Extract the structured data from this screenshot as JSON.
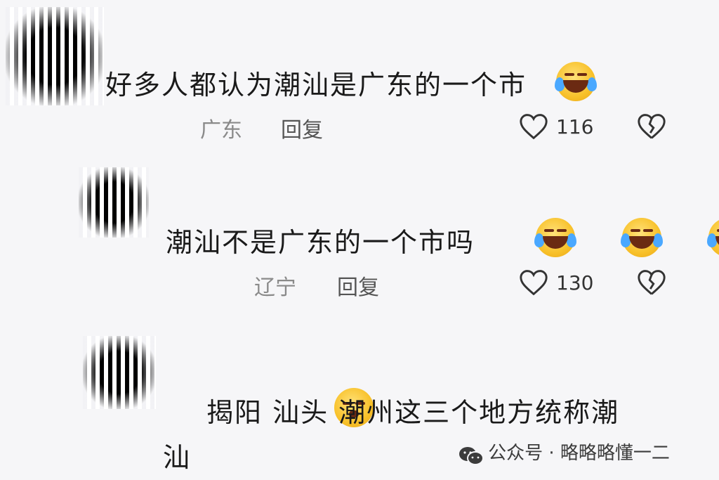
{
  "comments": [
    {
      "text": "好多人都认为潮汕是广东的一个市",
      "location": "广东",
      "reply_label": "回复",
      "likes": "116",
      "emoji": "laugh-cry-emoji"
    },
    {
      "text": "潮汕不是广东的一个市吗",
      "location": "辽宁",
      "reply_label": "回复",
      "likes": "130",
      "emoji": "laugh-cry-emoji"
    },
    {
      "text_line1": "揭阳 汕头 潮州这三个地方统称潮",
      "text_line2": "汕",
      "emoji": "sad-face-emoji"
    }
  ],
  "watermark": {
    "prefix": "公众号 · ",
    "account": "略略略懂一二"
  },
  "colors": {
    "background": "#f6f6f8",
    "text": "#1a1a1a",
    "meta": "#8a8a8a"
  }
}
